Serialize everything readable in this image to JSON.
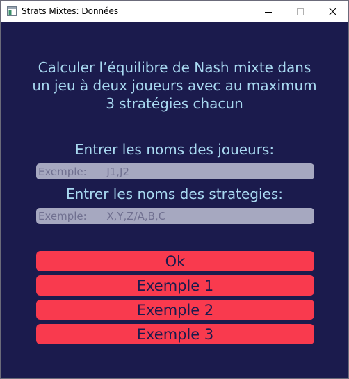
{
  "window": {
    "title": "Strats Mixtes: Données"
  },
  "main": {
    "heading_line1": "Calculer l’équilibre de Nash mixte dans",
    "heading_line2": "un jeu à deux joueurs avec au maximum",
    "heading_line3": "3 stratégies chacun",
    "players_label": "Entrer les noms des joueurs:",
    "players_input": {
      "value": "",
      "placeholder": "Exemple:      J1,J2"
    },
    "strategies_label": "Entrer les noms des strategies:",
    "strategies_input": {
      "value": "",
      "placeholder": "Exemple:      X,Y,Z/A,B,C"
    },
    "buttons": {
      "ok": "Ok",
      "example1": "Exemple 1",
      "example2": "Exemple 2",
      "example3": "Exemple 3"
    }
  },
  "colors": {
    "background": "#1b1b4d",
    "text": "#a8d8f0",
    "input_bg": "#a6a8c0",
    "button_bg": "#f93a4e"
  },
  "icons": {
    "app": "app-window-icon",
    "minimize": "minimize-icon",
    "maximize": "maximize-icon",
    "close": "close-icon"
  }
}
